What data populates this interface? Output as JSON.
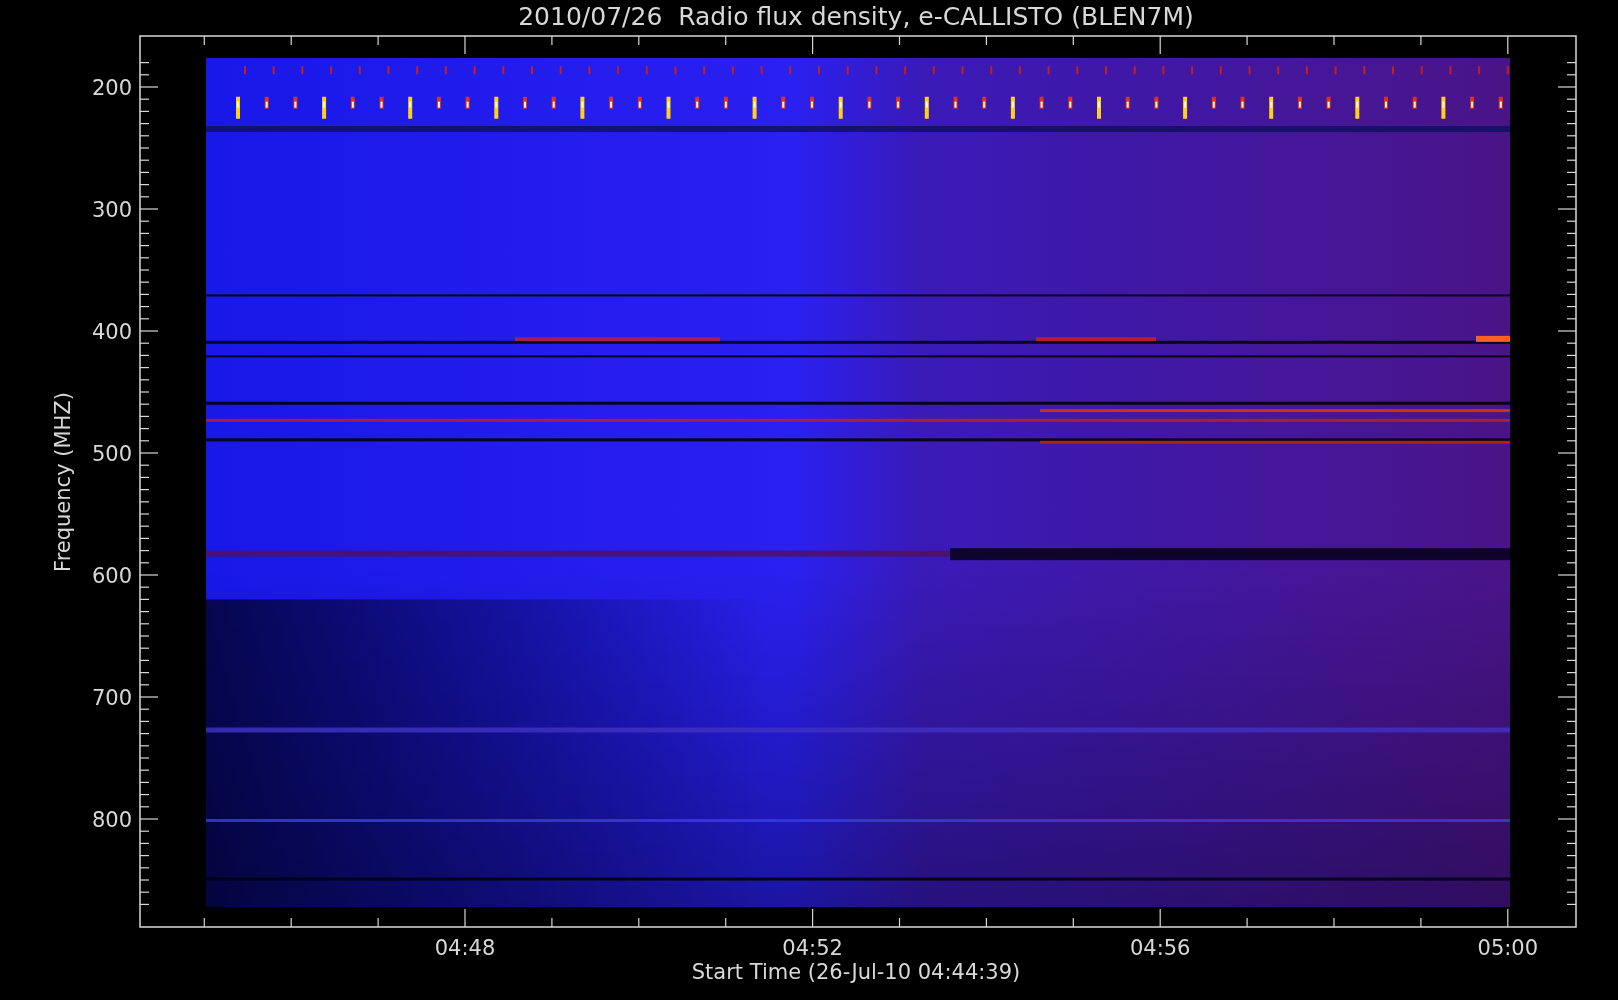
{
  "title": "2010/07/26  Radio flux density, e-CALLISTO (BLEN7M)",
  "y_axis": {
    "label": "Frequency (MHZ)",
    "tick_labels": [
      "200",
      "300",
      "400",
      "500",
      "600",
      "700",
      "800"
    ]
  },
  "x_axis": {
    "label": "Start Time (26-Jul-10 04:44:39)",
    "tick_labels": [
      "04:48",
      "04:52",
      "04:56",
      "05:00"
    ]
  }
}
